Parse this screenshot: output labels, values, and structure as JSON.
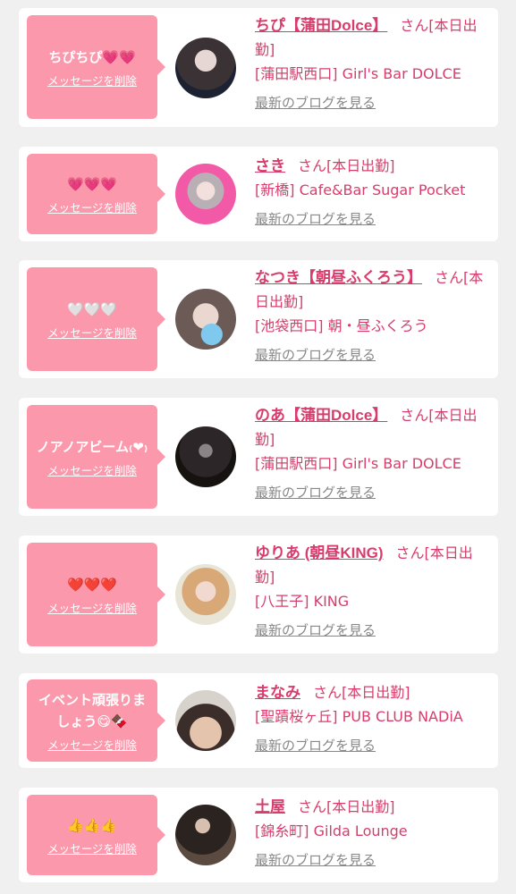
{
  "cards": [
    {
      "message": "ちぴちぴ💗💗",
      "delete_label": "メッセージを削除",
      "name": "ちぴ【蒲田Dolce】",
      "suffix": "さん[本日出勤]",
      "area": "[蒲田駅西口]",
      "shop": "Girl's Bar DOLCE",
      "blog_label": "最新のブログを見る"
    },
    {
      "message": "💗💗💗",
      "delete_label": "メッセージを削除",
      "name": "さき",
      "suffix": "さん[本日出勤]",
      "area": "[新橋]",
      "shop": "Cafe&Bar Sugar Pocket",
      "blog_label": "最新のブログを見る"
    },
    {
      "message": "🤍🤍🤍",
      "delete_label": "メッセージを削除",
      "name": "なつき【朝昼ふくろう】",
      "suffix": "さん[本日出勤]",
      "area": "[池袋西口]",
      "shop": "朝・昼ふくろう",
      "blog_label": "最新のブログを見る"
    },
    {
      "message": "ノアノアビーム₍❤︎₎",
      "delete_label": "メッセージを削除",
      "name": "のあ【蒲田Dolce】",
      "suffix": "さん[本日出勤]",
      "area": "[蒲田駅西口]",
      "shop": "Girl's Bar DOLCE",
      "blog_label": "最新のブログを見る"
    },
    {
      "message": "❤️❤️❤️",
      "delete_label": "メッセージを削除",
      "name": "ゆりあ (朝昼KING)",
      "suffix": "さん[本日出勤]",
      "area": "[八王子]",
      "shop": "KING",
      "blog_label": "最新のブログを見る"
    },
    {
      "message": "イベント頑張りましょう😋🍫",
      "delete_label": "メッセージを削除",
      "name": "まなみ",
      "suffix": "さん[本日出勤]",
      "area": "[聖蹟桜ヶ丘]",
      "shop": "PUB CLUB NADiA",
      "blog_label": "最新のブログを見る"
    },
    {
      "message": "👍👍👍",
      "delete_label": "メッセージを削除",
      "name": "土屋",
      "suffix": "さん[本日出勤]",
      "area": "[錦糸町]",
      "shop": "Gilda Lounge",
      "blog_label": "最新のブログを見る"
    }
  ],
  "colors": {
    "page_background": "#f0f0f0",
    "card_background": "#ffffff",
    "bubble": "#fc98ac",
    "accent_text": "#d93c6c",
    "link_gray": "#888888"
  }
}
